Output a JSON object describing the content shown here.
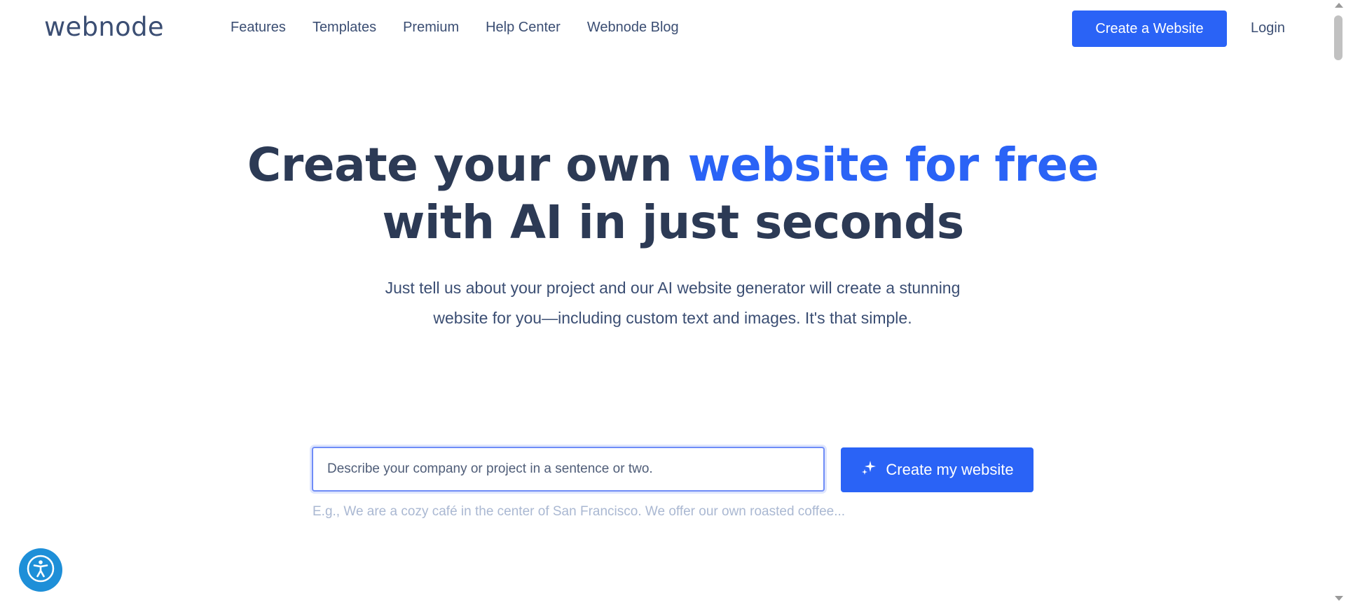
{
  "header": {
    "logo": "webnode",
    "nav": [
      "Features",
      "Templates",
      "Premium",
      "Help Center",
      "Webnode Blog"
    ],
    "cta_label": "Create a Website",
    "login_label": "Login"
  },
  "hero": {
    "title_part1": "Create your own ",
    "title_accent": "website for free",
    "title_part2": "with AI in just seconds",
    "subtitle": "Just tell us about your project and our AI website generator will create a stunning website for you—including custom text and images. It's that simple."
  },
  "form": {
    "input_placeholder": "Describe your company or project in a sentence or two.",
    "input_value": "",
    "submit_label": "Create my website",
    "example_text": "E.g., We are a cozy café in the center of San Francisco. We offer our own roasted coffee..."
  },
  "icons": {
    "submit": "sparkle-icon",
    "widget": "accessibility-icon"
  },
  "colors": {
    "accent": "#2a63f6",
    "text": "#2c3a55",
    "accessibility_widget": "#1e8fd8"
  }
}
